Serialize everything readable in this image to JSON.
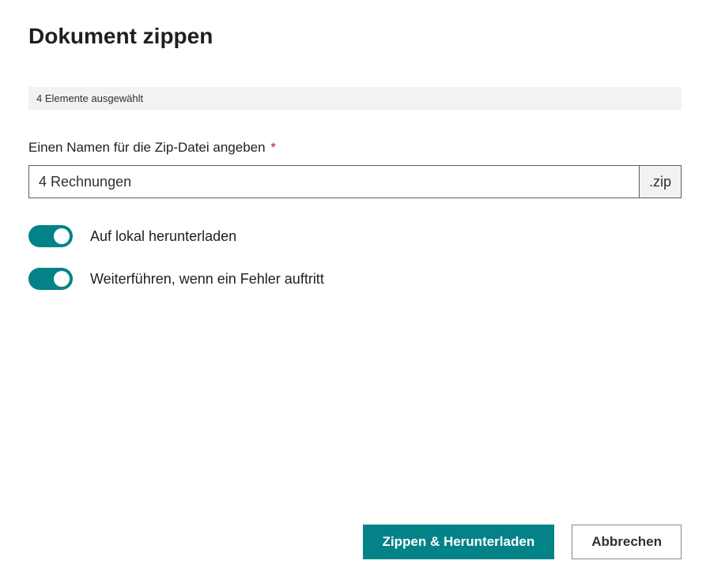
{
  "dialog": {
    "title": "Dokument zippen"
  },
  "status": {
    "text": "4  Elemente ausgewählt"
  },
  "filename_field": {
    "label": "Einen Namen für die Zip-Datei angeben",
    "required_marker": "*",
    "value": "4 Rechnungen",
    "suffix": ".zip"
  },
  "toggles": {
    "download_local": {
      "label": "Auf lokal herunterladen",
      "checked": true
    },
    "continue_on_error": {
      "label": "Weiterführen, wenn ein Fehler auftritt",
      "checked": true
    }
  },
  "buttons": {
    "primary": "Zippen & Herunterladen",
    "secondary": "Abbrechen"
  },
  "colors": {
    "accent": "#038387",
    "required": "#a4262c"
  }
}
